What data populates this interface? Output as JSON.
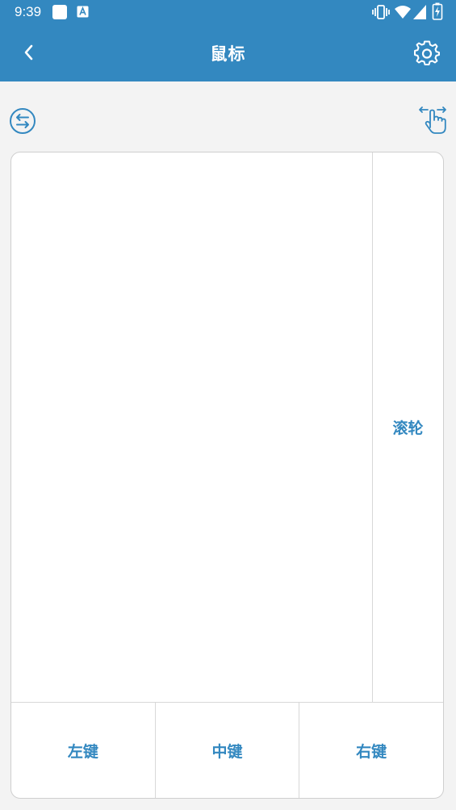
{
  "status_bar": {
    "time": "9:39",
    "icons": [
      "notification-square-icon",
      "app-a-icon",
      "vibrate-icon",
      "wifi-icon",
      "signal-icon",
      "battery-charging-icon"
    ]
  },
  "app_bar": {
    "title": "鼠标",
    "back_icon": "back-arrow-icon",
    "settings_icon": "gear-icon"
  },
  "toolbar": {
    "left_icon": "switch-arrows-icon",
    "right_icon": "swipe-gesture-icon"
  },
  "mouse_pad": {
    "scroll_label": "滚轮",
    "left_button": "左键",
    "middle_button": "中键",
    "right_button": "右键"
  },
  "colors": {
    "primary": "#3388c0",
    "background": "#f3f3f3",
    "pad": "#ffffff",
    "border": "#d8d8d8"
  }
}
